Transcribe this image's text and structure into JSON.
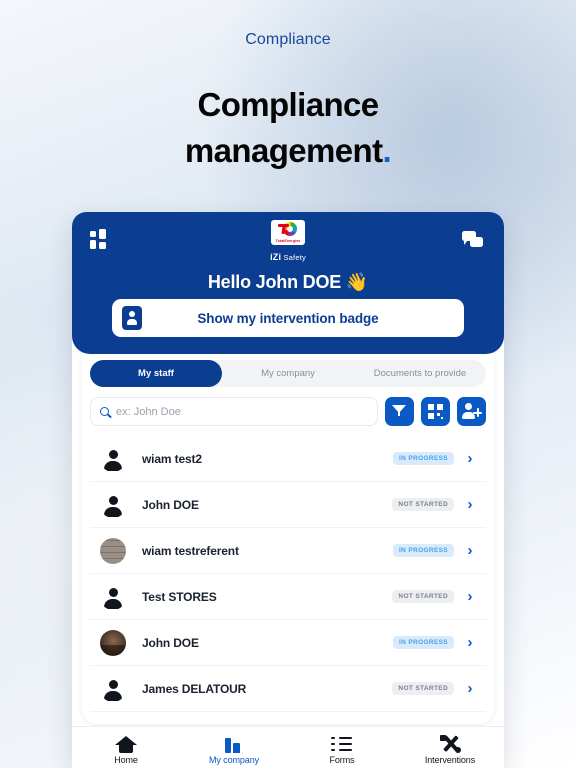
{
  "promo": {
    "eyebrow": "Compliance",
    "title_line1": "Compliance",
    "title_line2": "management",
    "title_dot": "."
  },
  "app": {
    "header": {
      "grid_icon": "grid-dashboard-icon",
      "chat_icon": "chat-bubbles-icon",
      "logo_word": "TotalEnergies",
      "logo_sub_brand": "iZi",
      "logo_sub_name": "Safety",
      "greeting": "Hello John DOE 👋",
      "badge_button_label": "Show my intervention badge",
      "badge_icon": "id-badge-icon",
      "bg_color": "#0b3d91"
    },
    "tabs": [
      {
        "label": "My staff",
        "active": true
      },
      {
        "label": "My company",
        "active": false
      },
      {
        "label": "Documents to provide",
        "active": false
      }
    ],
    "search": {
      "placeholder": "ex: John Doe",
      "value": "",
      "icon": "search-icon"
    },
    "actions": [
      {
        "name": "filter-button",
        "icon": "funnel-icon"
      },
      {
        "name": "qr-code-button",
        "icon": "qr-code-icon"
      },
      {
        "name": "add-person-button",
        "icon": "person-add-icon"
      }
    ],
    "staff": [
      {
        "name": "wiam test2",
        "status": "IN PROGRESS",
        "status_key": "inprogress",
        "avatar": "silhouette"
      },
      {
        "name": "John DOE",
        "status": "NOT STARTED",
        "status_key": "notstarted",
        "avatar": "silhouette"
      },
      {
        "name": "wiam testreferent",
        "status": "IN PROGRESS",
        "status_key": "inprogress",
        "avatar": "photo-brick"
      },
      {
        "name": "Test STORES",
        "status": "NOT STARTED",
        "status_key": "notstarted",
        "avatar": "silhouette"
      },
      {
        "name": "John DOE",
        "status": "IN PROGRESS",
        "status_key": "inprogress",
        "avatar": "photo-dark"
      },
      {
        "name": "James DELATOUR",
        "status": "NOT STARTED",
        "status_key": "notstarted",
        "avatar": "silhouette"
      }
    ],
    "chevron": "›",
    "bottom_nav": [
      {
        "label": "Home",
        "icon": "home-icon",
        "active": false
      },
      {
        "label": "My company",
        "icon": "building-icon",
        "active": true
      },
      {
        "label": "Forms",
        "icon": "checklist-icon",
        "active": false
      },
      {
        "label": "Interventions",
        "icon": "tools-icon",
        "active": false
      }
    ]
  },
  "colors": {
    "brand_blue": "#0b3d91",
    "accent_blue": "#0b59c4",
    "inprogress_bg": "#d9ebfb",
    "inprogress_fg": "#4aa0ea",
    "notstarted_bg": "#eceef1",
    "notstarted_fg": "#7c828c"
  }
}
